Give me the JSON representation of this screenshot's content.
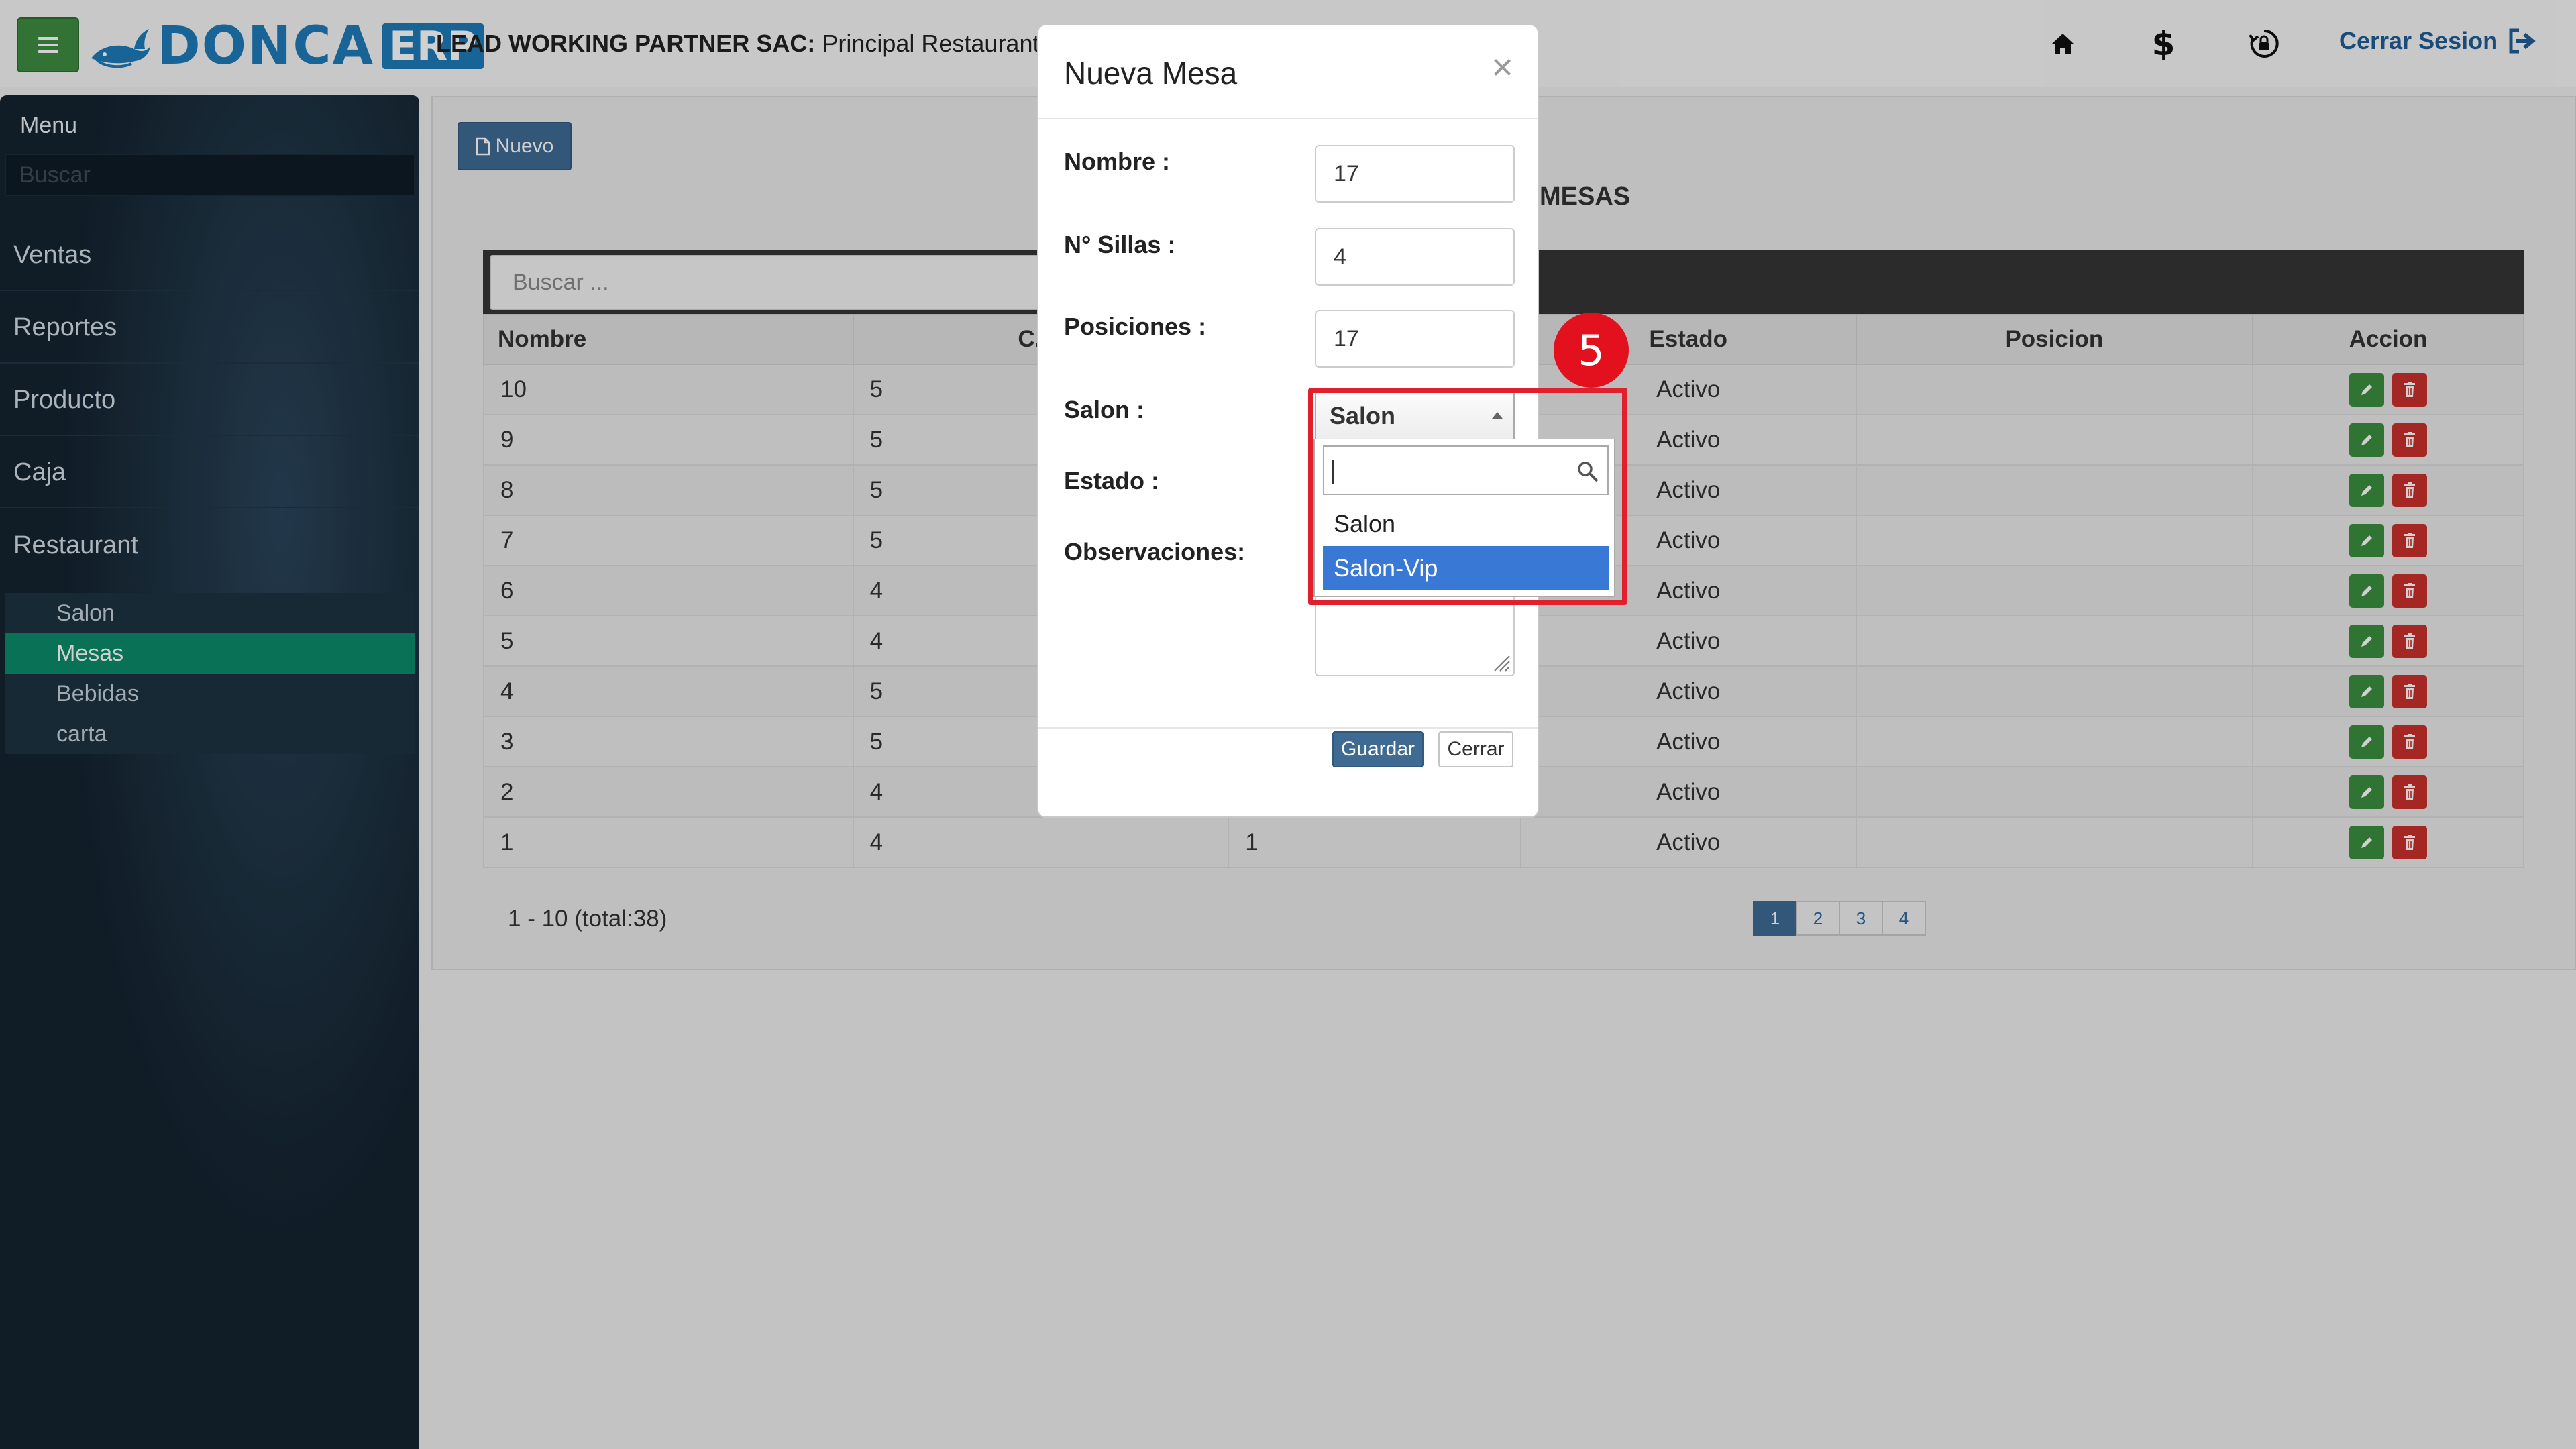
{
  "header": {
    "logo_text": "DONCA",
    "logo_badge": "ERP",
    "company_bold": "LEAD WORKING PARTNER SAC:",
    "company_rest": " Principal Restaurante",
    "logout_label": "Cerrar Sesion",
    "icons": [
      "home-icon",
      "dollar-icon",
      "lock-refresh-icon",
      "logout-icon"
    ]
  },
  "sidebar": {
    "title": "Menu",
    "search_placeholder": "Buscar",
    "items": [
      {
        "label": "Ventas"
      },
      {
        "label": "Reportes"
      },
      {
        "label": "Producto"
      },
      {
        "label": "Caja"
      },
      {
        "label": "Restaurant"
      }
    ],
    "subitems": [
      {
        "label": "Salon",
        "active": false
      },
      {
        "label": "Mesas",
        "active": true
      },
      {
        "label": "Bebidas",
        "active": false
      },
      {
        "label": "carta",
        "active": false
      }
    ]
  },
  "main": {
    "new_button": "Nuevo",
    "heading": "MESAS",
    "search_placeholder": "Buscar ...",
    "columns": [
      "Nombre",
      "C. S",
      "",
      "Estado",
      "Posicion",
      "Accion"
    ],
    "rows": [
      [
        "10",
        "5",
        "",
        "Activo",
        ""
      ],
      [
        "9",
        "5",
        "",
        "Activo",
        ""
      ],
      [
        "8",
        "5",
        "",
        "Activo",
        ""
      ],
      [
        "7",
        "5",
        "",
        "Activo",
        ""
      ],
      [
        "6",
        "4",
        "",
        "Activo",
        ""
      ],
      [
        "5",
        "4",
        "",
        "Activo",
        ""
      ],
      [
        "4",
        "5",
        "",
        "Activo",
        ""
      ],
      [
        "3",
        "5",
        "",
        "Activo",
        ""
      ],
      [
        "2",
        "4",
        "",
        "Activo",
        ""
      ],
      [
        "1",
        "4",
        "1",
        "Activo",
        ""
      ]
    ],
    "pager_info": "1 - 10 (total:38)",
    "pages": [
      "1",
      "2",
      "3",
      "4"
    ],
    "current_page": "1"
  },
  "modal": {
    "title": "Nueva Mesa",
    "close_glyph": "×",
    "fields": {
      "nombre_label": "Nombre :",
      "nombre_value": "17",
      "sillas_label": "N° Sillas :",
      "sillas_value": "4",
      "posiciones_label": "Posiciones :",
      "posiciones_value": "17",
      "salon_label": "Salon :",
      "salon_value": "Salon",
      "estado_label": "Estado :",
      "observaciones_label": "Observaciones:"
    },
    "dropdown_options": [
      "Salon",
      "Salon-Vip"
    ],
    "highlighted_option": "Salon-Vip",
    "save_label": "Guardar",
    "cancel_label": "Cerrar"
  },
  "annotation": {
    "step_number": "5",
    "color": "#e0202c"
  }
}
